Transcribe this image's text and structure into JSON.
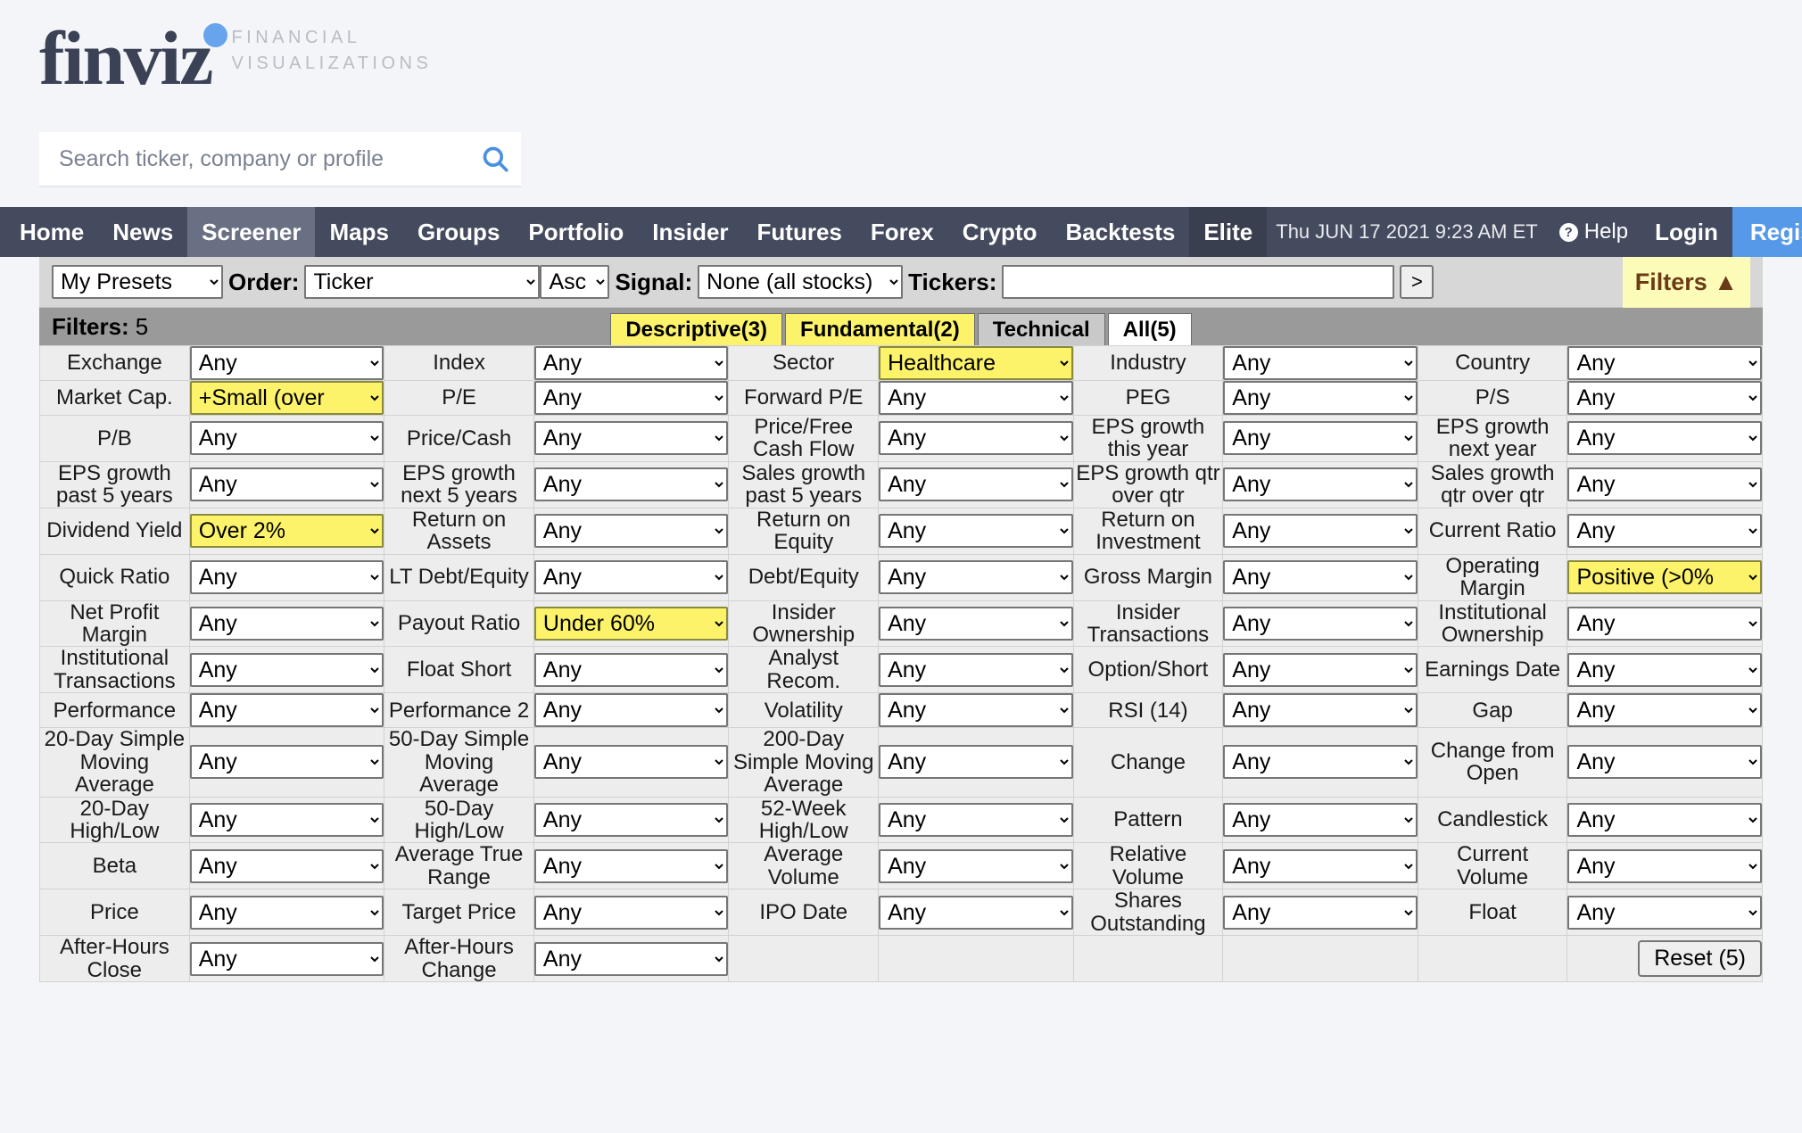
{
  "brand": {
    "name": "finviz",
    "tagline_line1": "FINANCIAL",
    "tagline_line2": "VISUALIZATIONS"
  },
  "search": {
    "placeholder": "Search ticker, company or profile",
    "value": "",
    "icon": "search-icon"
  },
  "nav": {
    "items": [
      {
        "label": "Home",
        "state": "normal"
      },
      {
        "label": "News",
        "state": "normal"
      },
      {
        "label": "Screener",
        "state": "active"
      },
      {
        "label": "Maps",
        "state": "normal"
      },
      {
        "label": "Groups",
        "state": "normal"
      },
      {
        "label": "Portfolio",
        "state": "normal"
      },
      {
        "label": "Insider",
        "state": "normal"
      },
      {
        "label": "Futures",
        "state": "normal"
      },
      {
        "label": "Forex",
        "state": "normal"
      },
      {
        "label": "Crypto",
        "state": "normal"
      },
      {
        "label": "Backtests",
        "state": "normal"
      },
      {
        "label": "Elite",
        "state": "dark"
      }
    ],
    "clock": "Thu JUN 17 2021 9:23 AM ET",
    "help_label": "Help",
    "help_icon": "question-mark-icon",
    "login_label": "Login",
    "register_label": "Register",
    "register_color": "#5599e8"
  },
  "toolbar": {
    "presets_value": "My Presets",
    "order_label": "Order:",
    "order_value": "Ticker",
    "direction_value": "Asc",
    "signal_label": "Signal:",
    "signal_value": "None (all stocks)",
    "tickers_label": "Tickers:",
    "tickers_value": "",
    "submit_label": ">",
    "filters_toggle_label": "Filters ▲"
  },
  "filterbar": {
    "filters_word": "Filters:",
    "filters_count": "5",
    "tabs": [
      {
        "label": "Descriptive(3)",
        "style": "yellow"
      },
      {
        "label": "Fundamental(2)",
        "style": "yellow"
      },
      {
        "label": "Technical",
        "style": "grey"
      },
      {
        "label": "All(5)",
        "style": "white"
      }
    ]
  },
  "reset": {
    "label": "Reset (5)"
  },
  "highlight_color": "#fcf36b",
  "filter_rows": [
    [
      {
        "label": "Exchange",
        "value": "Any",
        "hl": false
      },
      {
        "label": "Index",
        "value": "Any",
        "hl": false
      },
      {
        "label": "Sector",
        "value": "Healthcare",
        "hl": true
      },
      {
        "label": "Industry",
        "value": "Any",
        "hl": false
      },
      {
        "label": "Country",
        "value": "Any",
        "hl": false
      }
    ],
    [
      {
        "label": "Market Cap.",
        "value": "+Small (over",
        "hl": true
      },
      {
        "label": "P/E",
        "value": "Any",
        "hl": false
      },
      {
        "label": "Forward P/E",
        "value": "Any",
        "hl": false
      },
      {
        "label": "PEG",
        "value": "Any",
        "hl": false
      },
      {
        "label": "P/S",
        "value": "Any",
        "hl": false
      }
    ],
    [
      {
        "label": "P/B",
        "value": "Any",
        "hl": false
      },
      {
        "label": "Price/Cash",
        "value": "Any",
        "hl": false
      },
      {
        "label": "Price/Free Cash Flow",
        "value": "Any",
        "hl": false
      },
      {
        "label": "EPS growth this year",
        "value": "Any",
        "hl": false
      },
      {
        "label": "EPS growth next year",
        "value": "Any",
        "hl": false
      }
    ],
    [
      {
        "label": "EPS growth past 5 years",
        "value": "Any",
        "hl": false
      },
      {
        "label": "EPS growth next 5 years",
        "value": "Any",
        "hl": false
      },
      {
        "label": "Sales growth past 5 years",
        "value": "Any",
        "hl": false
      },
      {
        "label": "EPS growth qtr over qtr",
        "value": "Any",
        "hl": false
      },
      {
        "label": "Sales growth qtr over qtr",
        "value": "Any",
        "hl": false
      }
    ],
    [
      {
        "label": "Dividend Yield",
        "value": "Over 2%",
        "hl": true
      },
      {
        "label": "Return on Assets",
        "value": "Any",
        "hl": false
      },
      {
        "label": "Return on Equity",
        "value": "Any",
        "hl": false
      },
      {
        "label": "Return on Investment",
        "value": "Any",
        "hl": false
      },
      {
        "label": "Current Ratio",
        "value": "Any",
        "hl": false
      }
    ],
    [
      {
        "label": "Quick Ratio",
        "value": "Any",
        "hl": false
      },
      {
        "label": "LT Debt/Equity",
        "value": "Any",
        "hl": false
      },
      {
        "label": "Debt/Equity",
        "value": "Any",
        "hl": false
      },
      {
        "label": "Gross Margin",
        "value": "Any",
        "hl": false
      },
      {
        "label": "Operating Margin",
        "value": "Positive (>0%",
        "hl": true
      }
    ],
    [
      {
        "label": "Net Profit Margin",
        "value": "Any",
        "hl": false
      },
      {
        "label": "Payout Ratio",
        "value": "Under 60%",
        "hl": true
      },
      {
        "label": "Insider Ownership",
        "value": "Any",
        "hl": false
      },
      {
        "label": "Insider Transactions",
        "value": "Any",
        "hl": false
      },
      {
        "label": "Institutional Ownership",
        "value": "Any",
        "hl": false
      }
    ],
    [
      {
        "label": "Institutional Transactions",
        "value": "Any",
        "hl": false
      },
      {
        "label": "Float Short",
        "value": "Any",
        "hl": false
      },
      {
        "label": "Analyst Recom.",
        "value": "Any",
        "hl": false
      },
      {
        "label": "Option/Short",
        "value": "Any",
        "hl": false
      },
      {
        "label": "Earnings Date",
        "value": "Any",
        "hl": false
      }
    ],
    [
      {
        "label": "Performance",
        "value": "Any",
        "hl": false
      },
      {
        "label": "Performance 2",
        "value": "Any",
        "hl": false
      },
      {
        "label": "Volatility",
        "value": "Any",
        "hl": false
      },
      {
        "label": "RSI (14)",
        "value": "Any",
        "hl": false
      },
      {
        "label": "Gap",
        "value": "Any",
        "hl": false
      }
    ],
    [
      {
        "label": "20-Day Simple Moving Average",
        "value": "Any",
        "hl": false
      },
      {
        "label": "50-Day Simple Moving Average",
        "value": "Any",
        "hl": false
      },
      {
        "label": "200-Day Simple Moving Average",
        "value": "Any",
        "hl": false
      },
      {
        "label": "Change",
        "value": "Any",
        "hl": false
      },
      {
        "label": "Change from Open",
        "value": "Any",
        "hl": false
      }
    ],
    [
      {
        "label": "20-Day High/Low",
        "value": "Any",
        "hl": false
      },
      {
        "label": "50-Day High/Low",
        "value": "Any",
        "hl": false
      },
      {
        "label": "52-Week High/Low",
        "value": "Any",
        "hl": false
      },
      {
        "label": "Pattern",
        "value": "Any",
        "hl": false
      },
      {
        "label": "Candlestick",
        "value": "Any",
        "hl": false
      }
    ],
    [
      {
        "label": "Beta",
        "value": "Any",
        "hl": false
      },
      {
        "label": "Average True Range",
        "value": "Any",
        "hl": false
      },
      {
        "label": "Average Volume",
        "value": "Any",
        "hl": false
      },
      {
        "label": "Relative Volume",
        "value": "Any",
        "hl": false
      },
      {
        "label": "Current Volume",
        "value": "Any",
        "hl": false
      }
    ],
    [
      {
        "label": "Price",
        "value": "Any",
        "hl": false
      },
      {
        "label": "Target Price",
        "value": "Any",
        "hl": false
      },
      {
        "label": "IPO Date",
        "value": "Any",
        "hl": false
      },
      {
        "label": "Shares Outstanding",
        "value": "Any",
        "hl": false
      },
      {
        "label": "Float",
        "value": "Any",
        "hl": false
      }
    ],
    [
      {
        "label": "After-Hours Close",
        "value": "Any",
        "hl": false
      },
      {
        "label": "After-Hours Change",
        "value": "Any",
        "hl": false
      },
      {
        "label": "",
        "value": null,
        "hl": false
      },
      {
        "label": "",
        "value": null,
        "hl": false
      },
      {
        "label": "",
        "value": "__RESET__",
        "hl": false
      }
    ]
  ]
}
